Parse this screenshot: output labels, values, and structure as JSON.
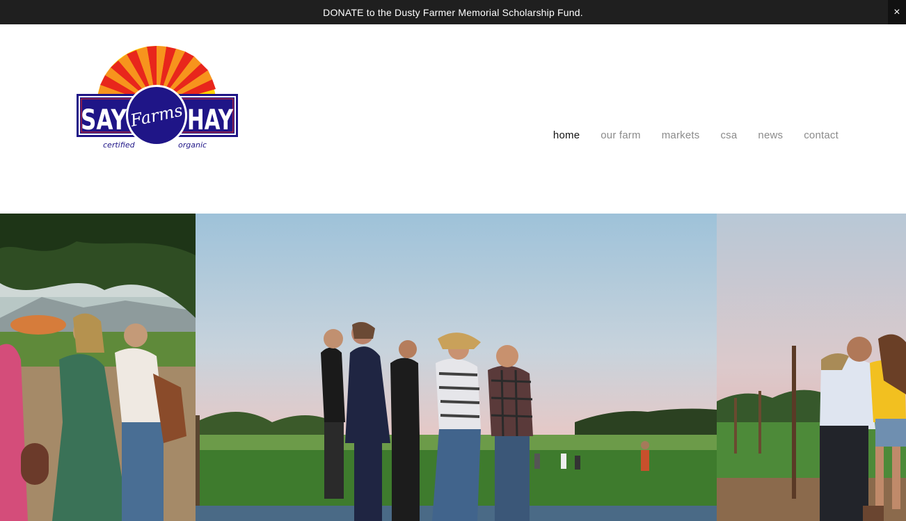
{
  "announcement": {
    "text": "DONATE to the Dusty Farmer Memorial Scholarship Fund.",
    "close_symbol": "×"
  },
  "logo": {
    "word_left": "SAY",
    "word_right": "HAY",
    "center_word": "Farms",
    "tag_left": "certified",
    "tag_right": "organic",
    "colors": {
      "navy": "#1f1587",
      "red": "#e8261c",
      "orange": "#f7941d",
      "yellow": "#ffd200"
    }
  },
  "nav": {
    "items": [
      {
        "label": "home",
        "active": true
      },
      {
        "label": "our farm",
        "active": false
      },
      {
        "label": "markets",
        "active": false
      },
      {
        "label": "csa",
        "active": false
      },
      {
        "label": "news",
        "active": false
      },
      {
        "label": "contact",
        "active": false
      }
    ]
  },
  "gallery": {
    "images": [
      {
        "alt_icon": "photo-people-under-tree"
      },
      {
        "alt_icon": "photo-group-at-sunset-field"
      },
      {
        "alt_icon": "photo-couple-laughing"
      }
    ]
  }
}
